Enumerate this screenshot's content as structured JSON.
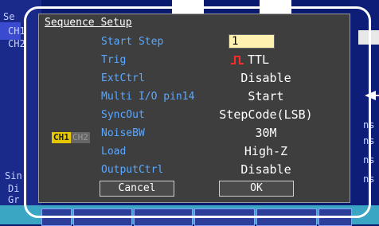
{
  "background": {
    "left_labels": [
      "Se",
      "CH1",
      "CH2"
    ],
    "bottom_left_labels": [
      "Sin",
      "Di",
      "Gr"
    ],
    "right_labels": [
      "ns",
      "ns",
      "ns",
      "ns"
    ],
    "bottom_buttons": [
      "",
      "",
      "",
      "",
      "",
      ""
    ]
  },
  "dialog": {
    "title": "Sequence Setup",
    "rows": [
      {
        "label": "Start Step",
        "value": "1"
      },
      {
        "label": "Trig",
        "value": "TTL"
      },
      {
        "label": "ExtCtrl",
        "value": "Disable"
      },
      {
        "label": "Multi I/O pin14",
        "value": "Start"
      },
      {
        "label": "SyncOut",
        "value": "StepCode(LSB)"
      },
      {
        "label": "NoiseBW",
        "value": "30M"
      },
      {
        "label": "Load",
        "value": "High-Z"
      },
      {
        "label": "OutputCtrl",
        "value": "Disable"
      }
    ],
    "channel_tags": {
      "ch1": "CH1",
      "ch2": "CH2"
    },
    "buttons": {
      "cancel": "Cancel",
      "ok": "OK"
    }
  },
  "colors": {
    "label_blue": "#5aa8ff",
    "dialog_bg": "#3e3e3e",
    "input_bg": "#fff2b0",
    "trig_icon": "#ff2a2a",
    "ch1_tag": "#e6c800"
  },
  "icons": {
    "trig": "rising-edge-trigger-icon",
    "arrow": "left-arrow-icon"
  }
}
